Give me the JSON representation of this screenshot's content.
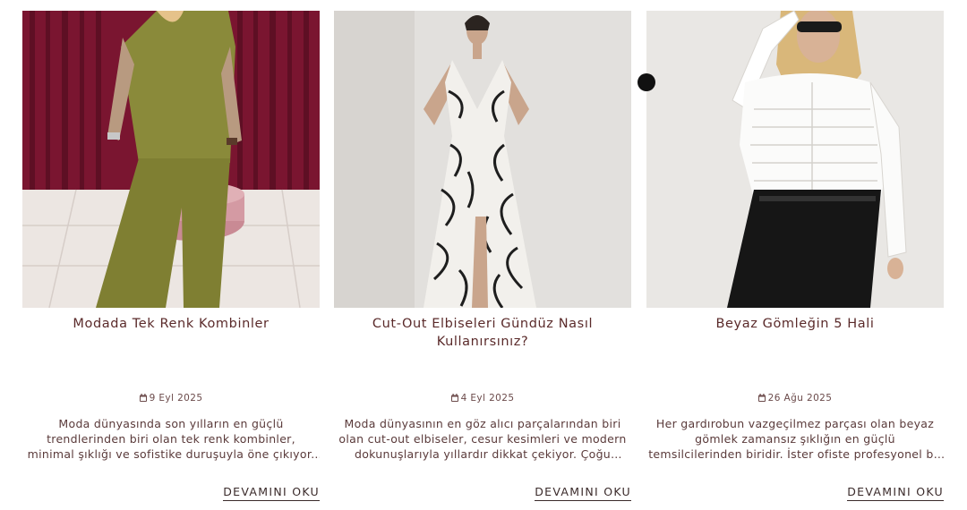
{
  "posts": [
    {
      "title": "Modada Tek Renk Kombinler",
      "date": "9 Eyl 2025",
      "excerpt": "Moda dünyasında son yılların en güçlü trendlerinden biri olan tek renk kombinler, minimal şıklığı ve sofistike duruşuyla öne çıkıyor. Monokrom stil olarak...",
      "read_more": "DEVAMINI OKU",
      "image": "olive-knit-set-photo"
    },
    {
      "title": "Cut-Out Elbiseleri Gündüz Nasıl Kullanırsınız?",
      "date": "4 Eyl 2025",
      "excerpt": "Moda dünyasının en göz alıcı parçalarından biri olan cut-out elbiseler, cesur kesimleri ve modern dokunuşlarıyla yıllardır dikkat çekiyor. Çoğu zaman...",
      "read_more": "DEVAMINI OKU",
      "image": "zebra-print-dress-photo"
    },
    {
      "title": "Beyaz Gömleğin 5 Hali",
      "date": "26 Ağu 2025",
      "excerpt": "Her gardırobun vazgeçilmez parçası olan beyaz gömlek zamansız şıklığın en güçlü temsilcilerinden biridir. İster ofiste profesyonel bir duruş sergilemek...",
      "read_more": "DEVAMINI OKU",
      "image": "white-shirt-photo"
    }
  ],
  "icons": {
    "date": "calendar-icon"
  },
  "colors": {
    "title": "#5a2a2a",
    "text": "#5a3a3a",
    "link": "#3a2a2a"
  }
}
